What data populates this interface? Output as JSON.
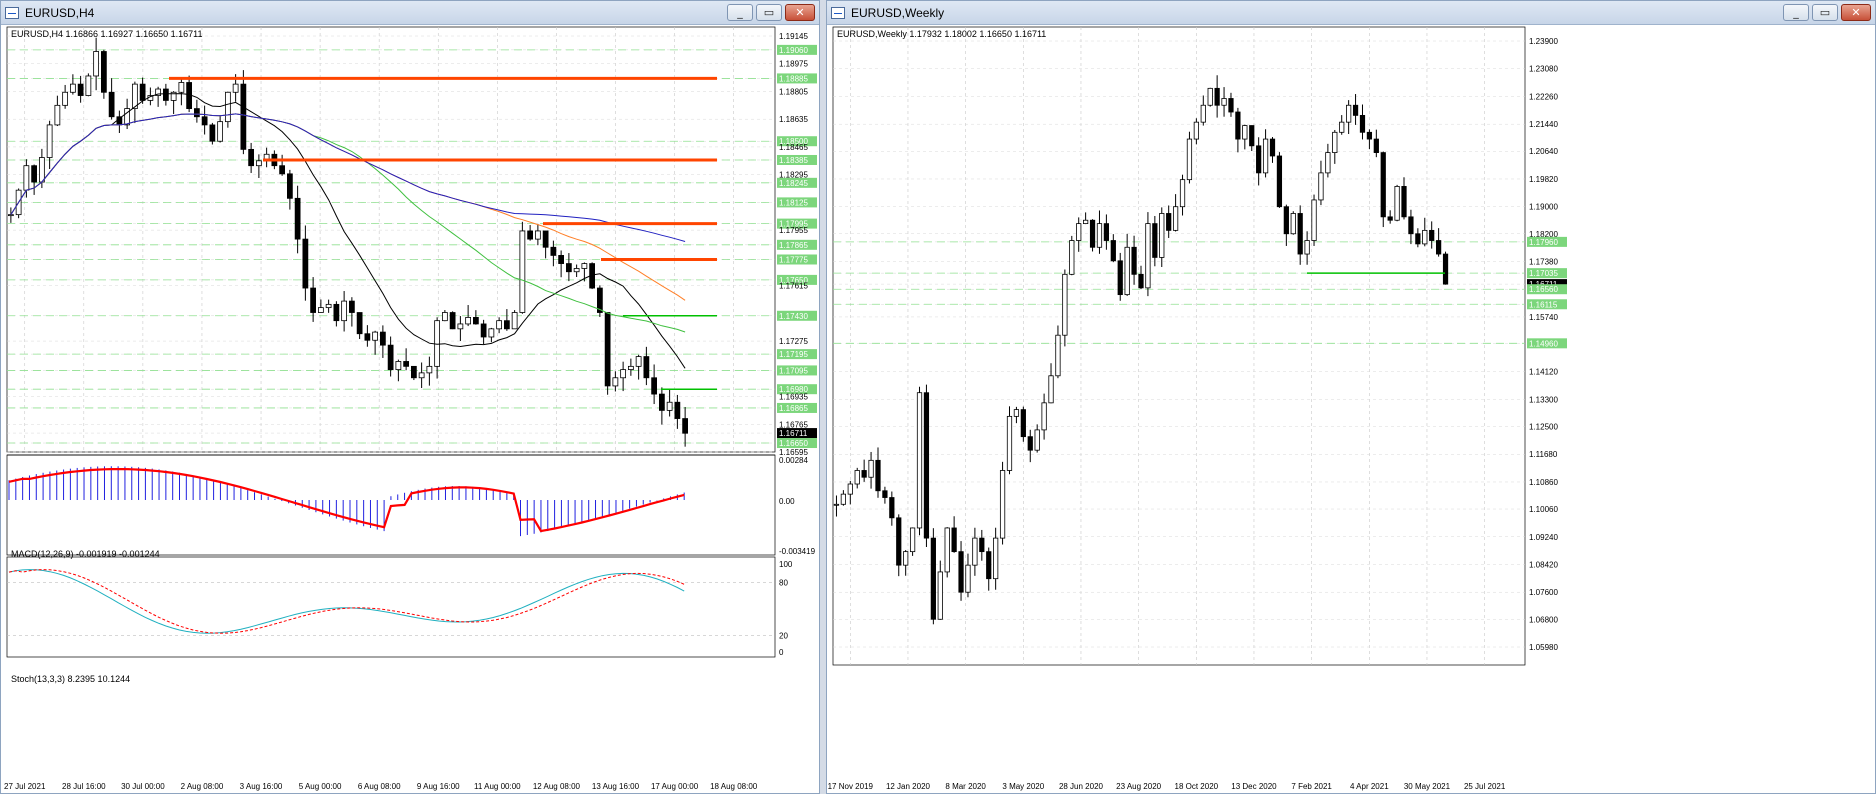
{
  "windows": [
    {
      "title": "EURUSD,H4",
      "chart_header": "EURUSD,H4  1.16866 1.16927 1.16650 1.16711",
      "price_labels": [
        "1.19145",
        "1.19060",
        "1.18975",
        "1.18885",
        "1.18805",
        "1.18635",
        "1.18500",
        "1.18465",
        "1.18385",
        "1.18295",
        "1.18245",
        "1.18125",
        "1.17995",
        "1.17955",
        "1.17865",
        "1.17775",
        "1.17650",
        "1.17615",
        "1.17430",
        "1.17275",
        "1.17195",
        "1.17095",
        "1.16980",
        "1.16935",
        "1.16865",
        "1.16765",
        "1.16711",
        "1.16650",
        "1.16595"
      ],
      "green_price_labels": [
        "1.19060",
        "1.18885",
        "1.18500",
        "1.18385",
        "1.18245",
        "1.18125",
        "1.17995",
        "1.17865",
        "1.17775",
        "1.17650",
        "1.17430",
        "1.17195",
        "1.17095",
        "1.16980",
        "1.16865",
        "1.16650"
      ],
      "current_price": "1.16711",
      "time_labels": [
        "27 Jul 2021",
        "28 Jul 16:00",
        "30 Jul 00:00",
        "2 Aug 08:00",
        "3 Aug 16:00",
        "5 Aug 00:00",
        "6 Aug 08:00",
        "9 Aug 16:00",
        "11 Aug 00:00",
        "12 Aug 08:00",
        "13 Aug 16:00",
        "17 Aug 00:00",
        "18 Aug 08:00"
      ],
      "macd_header": "MACD(12,26,9) -0.001919 -0.001244",
      "macd_labels": [
        "0.00284",
        "0.00",
        "-0.003419"
      ],
      "stoch_header": "Stoch(13,3,3) 8.2395 10.1244",
      "stoch_labels": [
        "100",
        "80",
        "20",
        "0"
      ]
    },
    {
      "title": "EURUSD,Weekly",
      "chart_header": "EURUSD,Weekly  1.17932 1.18002 1.16650 1.16711",
      "price_labels": [
        "1.23900",
        "1.23080",
        "1.22260",
        "1.21440",
        "1.20640",
        "1.19820",
        "1.19000",
        "1.18200",
        "1.17960",
        "1.17380",
        "1.17035",
        "1.16711",
        "1.16560",
        "1.16115",
        "1.15740",
        "1.14960",
        "1.14120",
        "1.13300",
        "1.12500",
        "1.11680",
        "1.10860",
        "1.10060",
        "1.09240",
        "1.08420",
        "1.07600",
        "1.06800",
        "1.05980"
      ],
      "green_price_labels": [
        "1.17960",
        "1.17035",
        "1.16560",
        "1.16115",
        "1.14960"
      ],
      "current_price": "1.16711",
      "time_labels": [
        "17 Nov 2019",
        "12 Jan 2020",
        "8 Mar 2020",
        "3 May 2020",
        "28 Jun 2020",
        "23 Aug 2020",
        "18 Oct 2020",
        "13 Dec 2020",
        "7 Feb 2021",
        "4 Apr 2021",
        "30 May 2021",
        "25 Jul 2021"
      ]
    }
  ],
  "buttons": {
    "minimize": "_",
    "restore": "▭",
    "close": "✕"
  },
  "colors": {
    "up_body": "#ffffff",
    "down_body": "#000000",
    "resistance": "#ff4500",
    "support": "#00c000",
    "macd_hist": "#2020e0",
    "macd_signal": "#ff0000",
    "stoch_main": "#20b0c0",
    "stoch_signal": "#ff0000",
    "ma_black": "#000000",
    "ma_blue": "#2020c0",
    "ma_orange": "#ff7f27",
    "ma_green": "#40c040"
  }
}
